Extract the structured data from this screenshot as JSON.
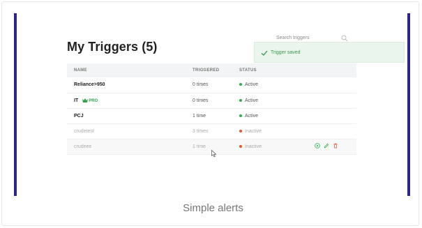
{
  "colors": {
    "frame": "#2d2590",
    "active": "#2fb04a",
    "inactive": "#e5562f",
    "toast_bg": "#eaf6ec",
    "toast_text": "#3a9a4c"
  },
  "page": {
    "title": "My Triggers (5)"
  },
  "search": {
    "placeholder": "Search triggers",
    "icon": "search-icon"
  },
  "toast": {
    "icon": "check-icon",
    "message": "Trigger saved"
  },
  "table": {
    "headers": [
      "NAME",
      "TRIGGERED",
      "STATUS"
    ],
    "rows": [
      {
        "name": "Reliance>950",
        "triggered": "0 times",
        "status": "Active",
        "badge": ""
      },
      {
        "name": "IT",
        "triggered": "0 times",
        "status": "Active",
        "badge": "PRO"
      },
      {
        "name": "PCJ",
        "triggered": "1 time",
        "status": "Active",
        "badge": ""
      },
      {
        "name": "crudetest",
        "triggered": "3 times",
        "status": "Inactive",
        "badge": ""
      },
      {
        "name": "crudeee",
        "triggered": "1 time",
        "status": "Inactive",
        "badge": ""
      }
    ],
    "row_actions": [
      "play-icon",
      "edit-icon",
      "trash-icon"
    ]
  },
  "caption": "Simple alerts"
}
